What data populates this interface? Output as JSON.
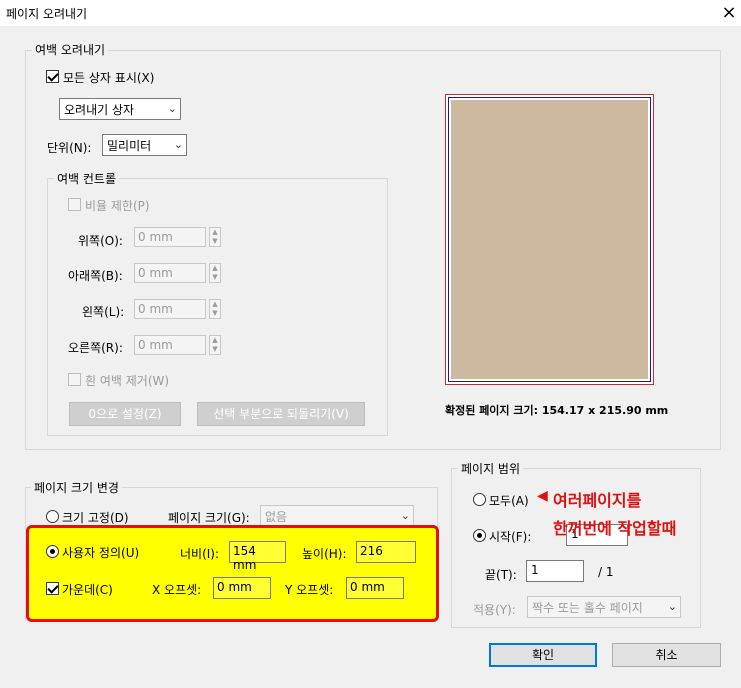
{
  "window": {
    "title": "페이지 오려내기",
    "close_icon": "×"
  },
  "margins_group": {
    "legend": "여백 오려내기",
    "show_all_boxes": {
      "label": "모든 상자 표시(X)",
      "checked": true
    },
    "box_select": {
      "value": "오려내기 상자"
    },
    "unit_label": "단위(N):",
    "unit_select": {
      "value": "밀리미터"
    }
  },
  "margin_controls": {
    "legend": "여백 컨트롤",
    "constrain": {
      "label": "비율 제한(P)",
      "checked": false
    },
    "top": {
      "label": "위쪽(O):",
      "value": "0 mm"
    },
    "bottom": {
      "label": "아래쪽(B):",
      "value": "0 mm"
    },
    "left": {
      "label": "왼쪽(L):",
      "value": "0 mm"
    },
    "right": {
      "label": "오른쪽(R):",
      "value": "0 mm"
    },
    "remove_white": {
      "label": "흰 여백 제거(W)",
      "checked": false
    },
    "set_zero_button": "0으로 설정(Z)",
    "revert_button": "선택 부분으로 되돌리기(V)"
  },
  "preview": {
    "page_color": "#cdb9a0",
    "size_text": "확정된 페이지 크기: 154.17 x 215.90 mm"
  },
  "page_size_group": {
    "legend": "페이지 크기 변경",
    "fixed": {
      "label": "크기 고정(D)",
      "selected": false
    },
    "page_size_label": "페이지 크기(G):",
    "page_size_select": "없음",
    "custom": {
      "label": "사용자 정의(U)",
      "selected": true
    },
    "width_label": "너비(I):",
    "width_value": "154 mm",
    "height_label": "높이(H):",
    "height_value": "216",
    "center": {
      "label": "가운데(C)",
      "checked": true
    },
    "x_offset_label": "X 오프셋:",
    "x_offset_value": "0 mm",
    "y_offset_label": "Y 오프셋:",
    "y_offset_value": "0 mm"
  },
  "page_range": {
    "legend": "페이지 범위",
    "all": {
      "label": "모두(A)",
      "selected": false
    },
    "from": {
      "label": "시작(F):",
      "selected": true,
      "value": "1"
    },
    "to": {
      "label": "끝(T):",
      "value": "1",
      "total": "/ 1"
    },
    "apply_label": "적용(Y):",
    "apply_select": "짝수 또는 홀수 페이지"
  },
  "annotation": {
    "arrow": "◀",
    "line1": "여러페이지를",
    "line2": "한꺼번에 작업할때"
  },
  "buttons": {
    "ok": "확인",
    "cancel": "취소"
  }
}
